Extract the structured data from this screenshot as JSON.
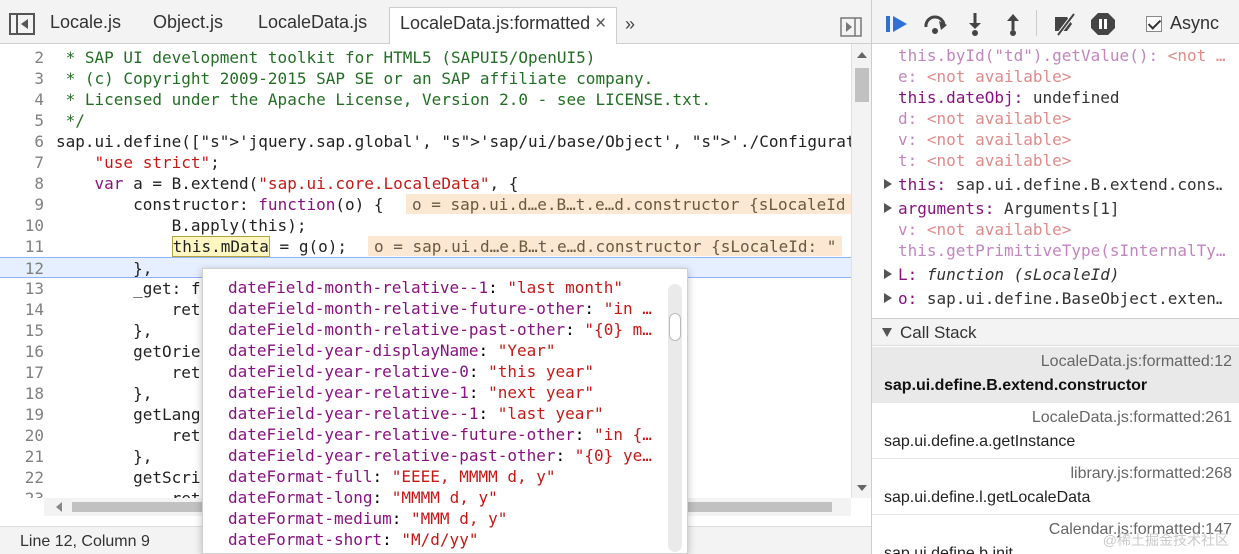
{
  "editor": {
    "tabs": [
      {
        "label": "Locale.js"
      },
      {
        "label": "Object.js"
      },
      {
        "label": "LocaleData.js"
      },
      {
        "label": "LocaleData.js:formatted"
      }
    ],
    "tab_close": "×",
    "tab_overflow": "»",
    "status": "Line 12, Column 9",
    "lines": [
      {
        "n": "2",
        "text": " * SAP UI development toolkit for HTML5 (SAPUI5/OpenUI5)"
      },
      {
        "n": "3",
        "text": " * (c) Copyright 2009-2015 SAP SE or an SAP affiliate company."
      },
      {
        "n": "4",
        "text": " * Licensed under the Apache License, Version 2.0 - see LICENSE.txt."
      },
      {
        "n": "5",
        "text": " */"
      },
      {
        "n": "6",
        "text": "sap.ui.define(['jquery.sap.global', 'sap/ui/base/Object', './Configuration', './L"
      },
      {
        "n": "7",
        "text": "    \"use strict\";"
      },
      {
        "n": "8",
        "text": "    var a = B.extend(\"sap.ui.core.LocaleData\", {"
      },
      {
        "n": "9",
        "text": "        constructor: function(o) {"
      },
      {
        "n": "10",
        "text": "            B.apply(this);"
      },
      {
        "n": "11",
        "text": "            this.mData = g(o);"
      },
      {
        "n": "12",
        "text": "        },"
      },
      {
        "n": "13",
        "text": "        _get: f"
      },
      {
        "n": "14",
        "text": "            ret"
      },
      {
        "n": "15",
        "text": "        },"
      },
      {
        "n": "16",
        "text": "        getOrie"
      },
      {
        "n": "17",
        "text": "            ret"
      },
      {
        "n": "18",
        "text": "        },"
      },
      {
        "n": "19",
        "text": "        getLang"
      },
      {
        "n": "20",
        "text": "            ret"
      },
      {
        "n": "21",
        "text": "        },"
      },
      {
        "n": "22",
        "text": "        getScri"
      },
      {
        "n": "23",
        "text": "            ret"
      },
      {
        "n": "24",
        "text": ""
      }
    ],
    "inline_values": {
      "line9": "o = sap.ui.d…e.B…t.e…d.constructor {sLocaleId",
      "line11": "o = sap.ui.d…e.B…t.e…d.constructor {sLocaleId: \""
    }
  },
  "popover": {
    "entries": [
      {
        "key": "dateField-month-relative--1",
        "value": "\"last month\""
      },
      {
        "key": "dateField-month-relative-future-other",
        "value": "\"in …"
      },
      {
        "key": "dateField-month-relative-past-other",
        "value": "\"{0} m…"
      },
      {
        "key": "dateField-year-displayName",
        "value": "\"Year\""
      },
      {
        "key": "dateField-year-relative-0",
        "value": "\"this year\""
      },
      {
        "key": "dateField-year-relative-1",
        "value": "\"next year\""
      },
      {
        "key": "dateField-year-relative--1",
        "value": "\"last year\""
      },
      {
        "key": "dateField-year-relative-future-other",
        "value": "\"in {…"
      },
      {
        "key": "dateField-year-relative-past-other",
        "value": "\"{0} ye…"
      },
      {
        "key": "dateFormat-full",
        "value": "\"EEEE, MMMM d, y\""
      },
      {
        "key": "dateFormat-long",
        "value": "\"MMMM d, y\""
      },
      {
        "key": "dateFormat-medium",
        "value": "\"MMM d, y\""
      },
      {
        "key": "dateFormat-short",
        "value": "\"M/d/yy\""
      }
    ]
  },
  "debugger": {
    "async_label": "Async",
    "scope": [
      {
        "type": "watch",
        "name": "this.byId(\"td\").getValue()",
        "value": "<not …"
      },
      {
        "type": "watch",
        "name": "e",
        "value": "<not available>"
      },
      {
        "type": "watch-ok",
        "name": "this.dateObj",
        "value": "undefined"
      },
      {
        "type": "watch",
        "name": "d",
        "value": "<not available>"
      },
      {
        "type": "watch",
        "name": "v",
        "value": "<not available>"
      },
      {
        "type": "watch",
        "name": "t",
        "value": "<not available>"
      },
      {
        "type": "obj",
        "name": "this",
        "value": "sap.ui.define.B.extend.cons…"
      },
      {
        "type": "obj",
        "name": "arguments",
        "value": "Arguments[1]"
      },
      {
        "type": "watch",
        "name": "v",
        "value": "<not available>"
      },
      {
        "type": "watch-plain",
        "name": "this.getPrimitiveType(sInternalTy…",
        "value": ""
      },
      {
        "type": "func",
        "name": "L",
        "value": "function (sLocaleId)"
      },
      {
        "type": "obj",
        "name": "o",
        "value": "sap.ui.define.BaseObject.exten…"
      }
    ],
    "callstack_title": "Call Stack",
    "frames": [
      {
        "location": "LocaleData.js:formatted:12",
        "function": "sap.ui.define.B.extend.constructor"
      },
      {
        "location": "LocaleData.js:formatted:261",
        "function": "sap.ui.define.a.getInstance"
      },
      {
        "location": "library.js:formatted:268",
        "function": "sap.ui.define.l.getLocaleData"
      },
      {
        "location": "Calendar.js:formatted:147",
        "function": "sap.ui.define.b.init"
      }
    ],
    "watermark": "@稀土掘金技术社区"
  }
}
